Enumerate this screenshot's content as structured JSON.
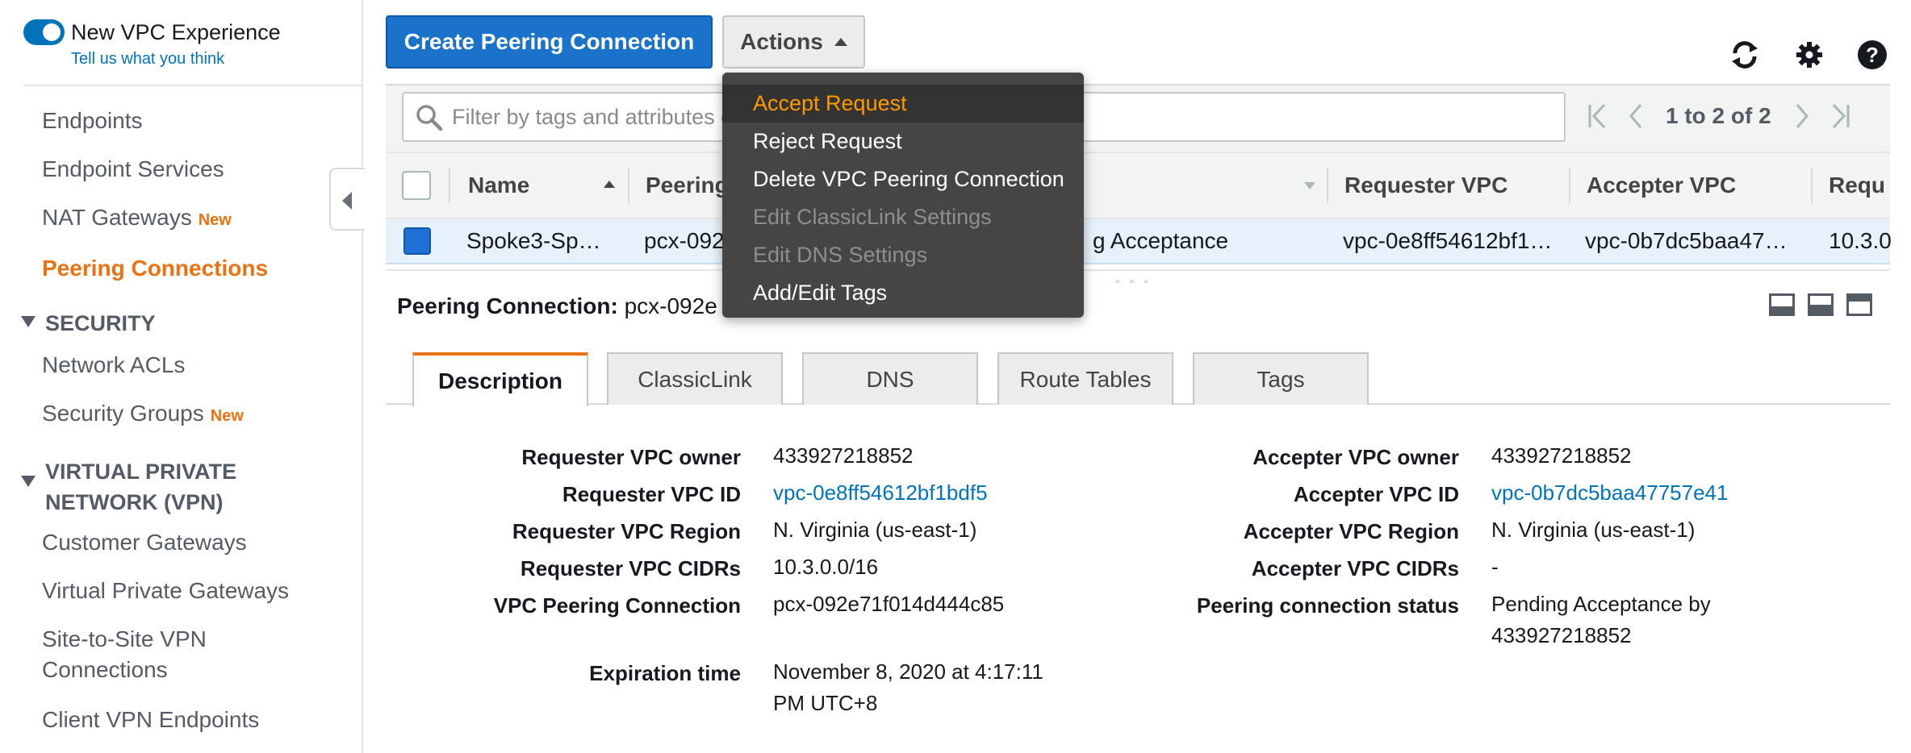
{
  "sidebar": {
    "experience_title": "New VPC Experience",
    "experience_link": "Tell us what you think",
    "items": [
      {
        "label": "Endpoints"
      },
      {
        "label": "Endpoint Services"
      },
      {
        "label": "NAT Gateways",
        "badge": "New"
      },
      {
        "label": "Peering Connections"
      }
    ],
    "security": {
      "heading": "SECURITY",
      "items": [
        {
          "label": "Network ACLs"
        },
        {
          "label": "Security Groups",
          "badge": "New"
        }
      ]
    },
    "vpn": {
      "heading_line1": "VIRTUAL PRIVATE",
      "heading_line2": "NETWORK (VPN)",
      "items": [
        {
          "label": "Customer Gateways"
        },
        {
          "label": "Virtual Private Gateways"
        },
        {
          "label_line1": "Site-to-Site VPN",
          "label_line2": "Connections"
        },
        {
          "label": "Client VPN Endpoints"
        }
      ]
    }
  },
  "toolbar": {
    "create_label": "Create Peering Connection",
    "actions_label": "Actions"
  },
  "actions_menu": [
    {
      "label": "Accept Request"
    },
    {
      "label": "Reject Request"
    },
    {
      "label": "Delete VPC Peering Connection"
    },
    {
      "label": "Edit ClassicLink Settings"
    },
    {
      "label": "Edit DNS Settings"
    },
    {
      "label": "Add/Edit Tags"
    }
  ],
  "search": {
    "placeholder": "Filter by tags and attributes o"
  },
  "pager": {
    "text": "1 to 2 of 2"
  },
  "table": {
    "columns": [
      "Name",
      "Peering",
      "Requester VPC",
      "Accepter VPC",
      "Requ"
    ],
    "row": {
      "name": "Spoke3-Sp…",
      "peering_id": "pcx-092",
      "status": "g Acceptance",
      "requester_vpc": "vpc-0e8ff54612bf1…",
      "accepter_vpc": "vpc-0b7dc5baa47…",
      "requester_cidr": "10.3.0"
    }
  },
  "details": {
    "header_label": "Peering Connection:",
    "header_value": "pcx-092e",
    "tabs": [
      "Description",
      "ClassicLink",
      "DNS",
      "Route Tables",
      "Tags"
    ],
    "left": [
      {
        "label": "Requester VPC owner",
        "value": "433927218852"
      },
      {
        "label": "Requester VPC ID",
        "value": "vpc-0e8ff54612bf1bdf5"
      },
      {
        "label": "Requester VPC Region",
        "value": "N. Virginia (us-east-1)"
      },
      {
        "label": "Requester VPC CIDRs",
        "value": "10.3.0.0/16"
      },
      {
        "label": "VPC Peering Connection",
        "value": "pcx-092e71f014d444c85"
      },
      {
        "label": "Expiration time",
        "value_line1": "November 8, 2020 at 4:17:11",
        "value_line2": "PM UTC+8"
      }
    ],
    "right": [
      {
        "label": "Accepter VPC owner",
        "value": "433927218852"
      },
      {
        "label": "Accepter VPC ID",
        "value": "vpc-0b7dc5baa47757e41"
      },
      {
        "label": "Accepter VPC Region",
        "value": "N. Virginia (us-east-1)"
      },
      {
        "label": "Accepter VPC CIDRs",
        "value": "-"
      },
      {
        "label": "Peering connection status",
        "value_line1": "Pending Acceptance by",
        "value_line2": "433927218852"
      }
    ]
  },
  "colors": {
    "accent": "#ec7211",
    "primary_button": "#1a73c9",
    "link": "#0073bb",
    "menu_bg": "#454545",
    "menu_highlight": "#ff9900"
  },
  "icons": [
    "toggle-icon",
    "refresh-icon",
    "gear-icon",
    "help-icon",
    "search-icon",
    "first-page-icon",
    "prev-page-icon",
    "next-page-icon",
    "last-page-icon",
    "sort-asc-icon",
    "dropdown-caret-icon",
    "collapse-arrow-icon"
  ]
}
